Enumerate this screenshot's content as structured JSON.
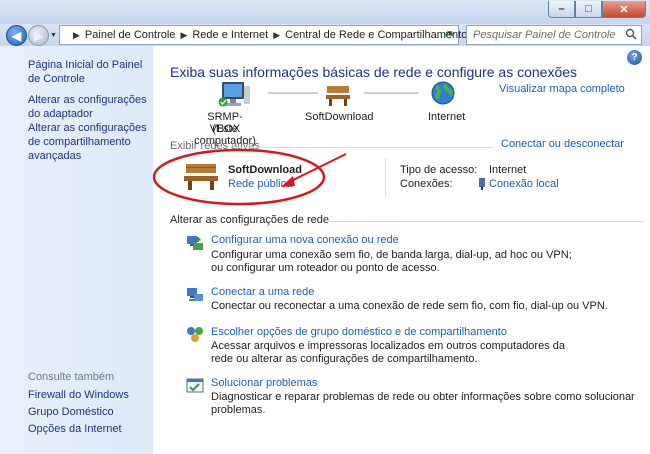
{
  "window": {
    "controls": {
      "minimize": "–",
      "maximize": "□",
      "close": "✕"
    }
  },
  "address_bar": {
    "crumbs": [
      "Painel de Controle",
      "Rede e Internet",
      "Central de Rede e Compartilhamento"
    ],
    "search_placeholder": "Pesquisar Painel de Controle"
  },
  "sidebar": {
    "links": [
      "Página Inicial do Painel de Controle",
      "Alterar as configurações do adaptador",
      "Alterar as configurações de compartilhamento avançadas"
    ],
    "see_also_heading": "Consulte também",
    "see_also": [
      "Firewall do Windows",
      "Grupo Doméstico",
      "Opções da Internet"
    ]
  },
  "main": {
    "heading": "Exiba suas informações básicas de rede e configure as conexões",
    "view_map": "Visualizar mapa completo",
    "map": {
      "computer_name": "SRMP-VBOX",
      "computer_sub": "(Este computador)",
      "network_name": "SoftDownload",
      "internet": "Internet"
    },
    "active_heading": "Exibir redes ativas",
    "connect_disconnect": "Conectar ou desconectar",
    "active_network": {
      "name": "SoftDownload",
      "type": "Rede pública",
      "access_label": "Tipo de acesso:",
      "access_value": "Internet",
      "connections_label": "Conexões:",
      "connections_value": "Conexão local"
    },
    "change_heading": "Alterar as configurações de rede",
    "tasks": [
      {
        "title": "Configurar uma nova conexão ou rede",
        "desc": "Configurar uma conexão sem fio, de banda larga, dial-up, ad hoc ou VPN; ou configurar um roteador ou ponto de acesso."
      },
      {
        "title": "Conectar a uma rede",
        "desc": "Conectar ou reconectar a uma conexão de rede sem fio, com fio, dial-up ou VPN."
      },
      {
        "title": "Escolher opções de grupo doméstico e de compartilhamento",
        "desc": "Acessar arquivos e impressoras localizados em outros computadores da rede ou alterar as configurações de compartilhamento."
      },
      {
        "title": "Solucionar problemas",
        "desc": "Diagnosticar e reparar problemas de rede ou obter informações sobre como solucionar problemas."
      }
    ]
  },
  "colors": {
    "link": "#1e5eb5",
    "heading": "#1e3287",
    "annotation": "#d8161b"
  }
}
